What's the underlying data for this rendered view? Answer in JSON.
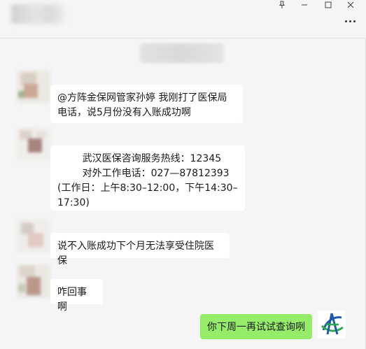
{
  "window": {
    "pin_icon": "pin-icon",
    "minimize_icon": "minimize-icon",
    "maximize_icon": "maximize-icon",
    "close_icon": "close-icon",
    "more_icon": "more-icon"
  },
  "messages": [
    {
      "sender": "other",
      "text": "@方阵金保网管家孙婷 我刚打了医保局电话，说5月份没有入账成功啊"
    },
    {
      "sender": "other",
      "text": "        武汉医保咨询服务热线：12345\n        对外工作电话：027—87812393 (工作日：上午8:30–12:00，下午14:30–17:30)"
    },
    {
      "sender": "other",
      "text": "说不入账成功下个月无法享受住院医保"
    },
    {
      "sender": "other",
      "text": "咋回事啊"
    },
    {
      "sender": "self",
      "text": "你下周一再试试查询咧"
    }
  ],
  "colors": {
    "self_bubble": "#95ec69",
    "other_bubble": "#ffffff",
    "background": "#f5f5f5",
    "logo_blue": "#1e5aa8",
    "logo_green": "#2aa84a"
  }
}
